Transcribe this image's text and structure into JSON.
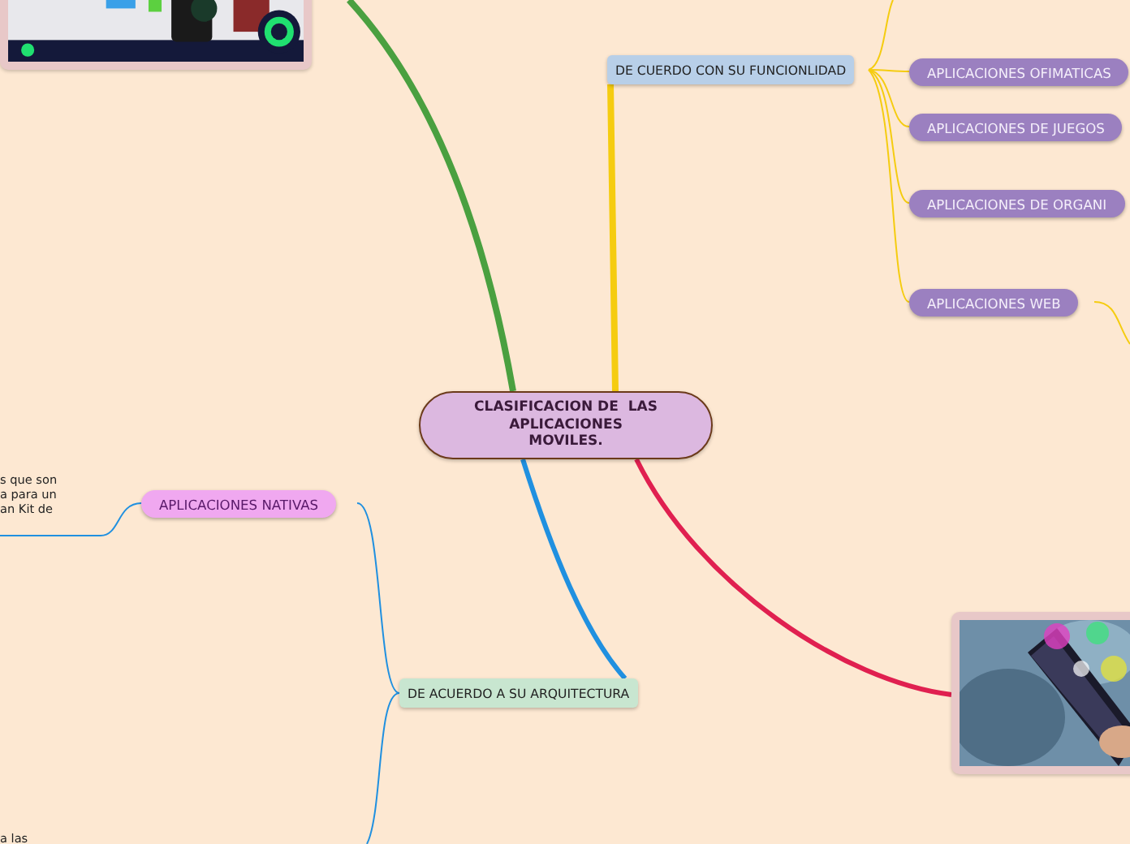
{
  "central_topic": {
    "text": "CLASIFICACION DE  LAS\nAPLICACIONES\nMOVILES."
  },
  "topics": [
    {
      "kind": "function",
      "text": "DE CUERDO CON SU FUNCIONLIDAD"
    },
    {
      "kind": "architecture",
      "text": "DE ACUERDO A SU ARQUITECTURA"
    }
  ],
  "subtopics": [
    {
      "kind": "purple",
      "text": "APLICACIONES OFIMATICAS"
    },
    {
      "kind": "purple",
      "text": "APLICACIONES DE JUEGOS"
    },
    {
      "kind": "purple",
      "text": "APLICACIONES DE ORGANI"
    },
    {
      "kind": "purple",
      "text": "APLICACIONES WEB"
    },
    {
      "kind": "pink",
      "text": "APLICACIONES NATIVAS"
    }
  ],
  "notes": [
    {
      "lines": [
        "s que son",
        "a para un",
        "an Kit de"
      ]
    },
    {
      "lines": [
        "a las"
      ]
    }
  ]
}
